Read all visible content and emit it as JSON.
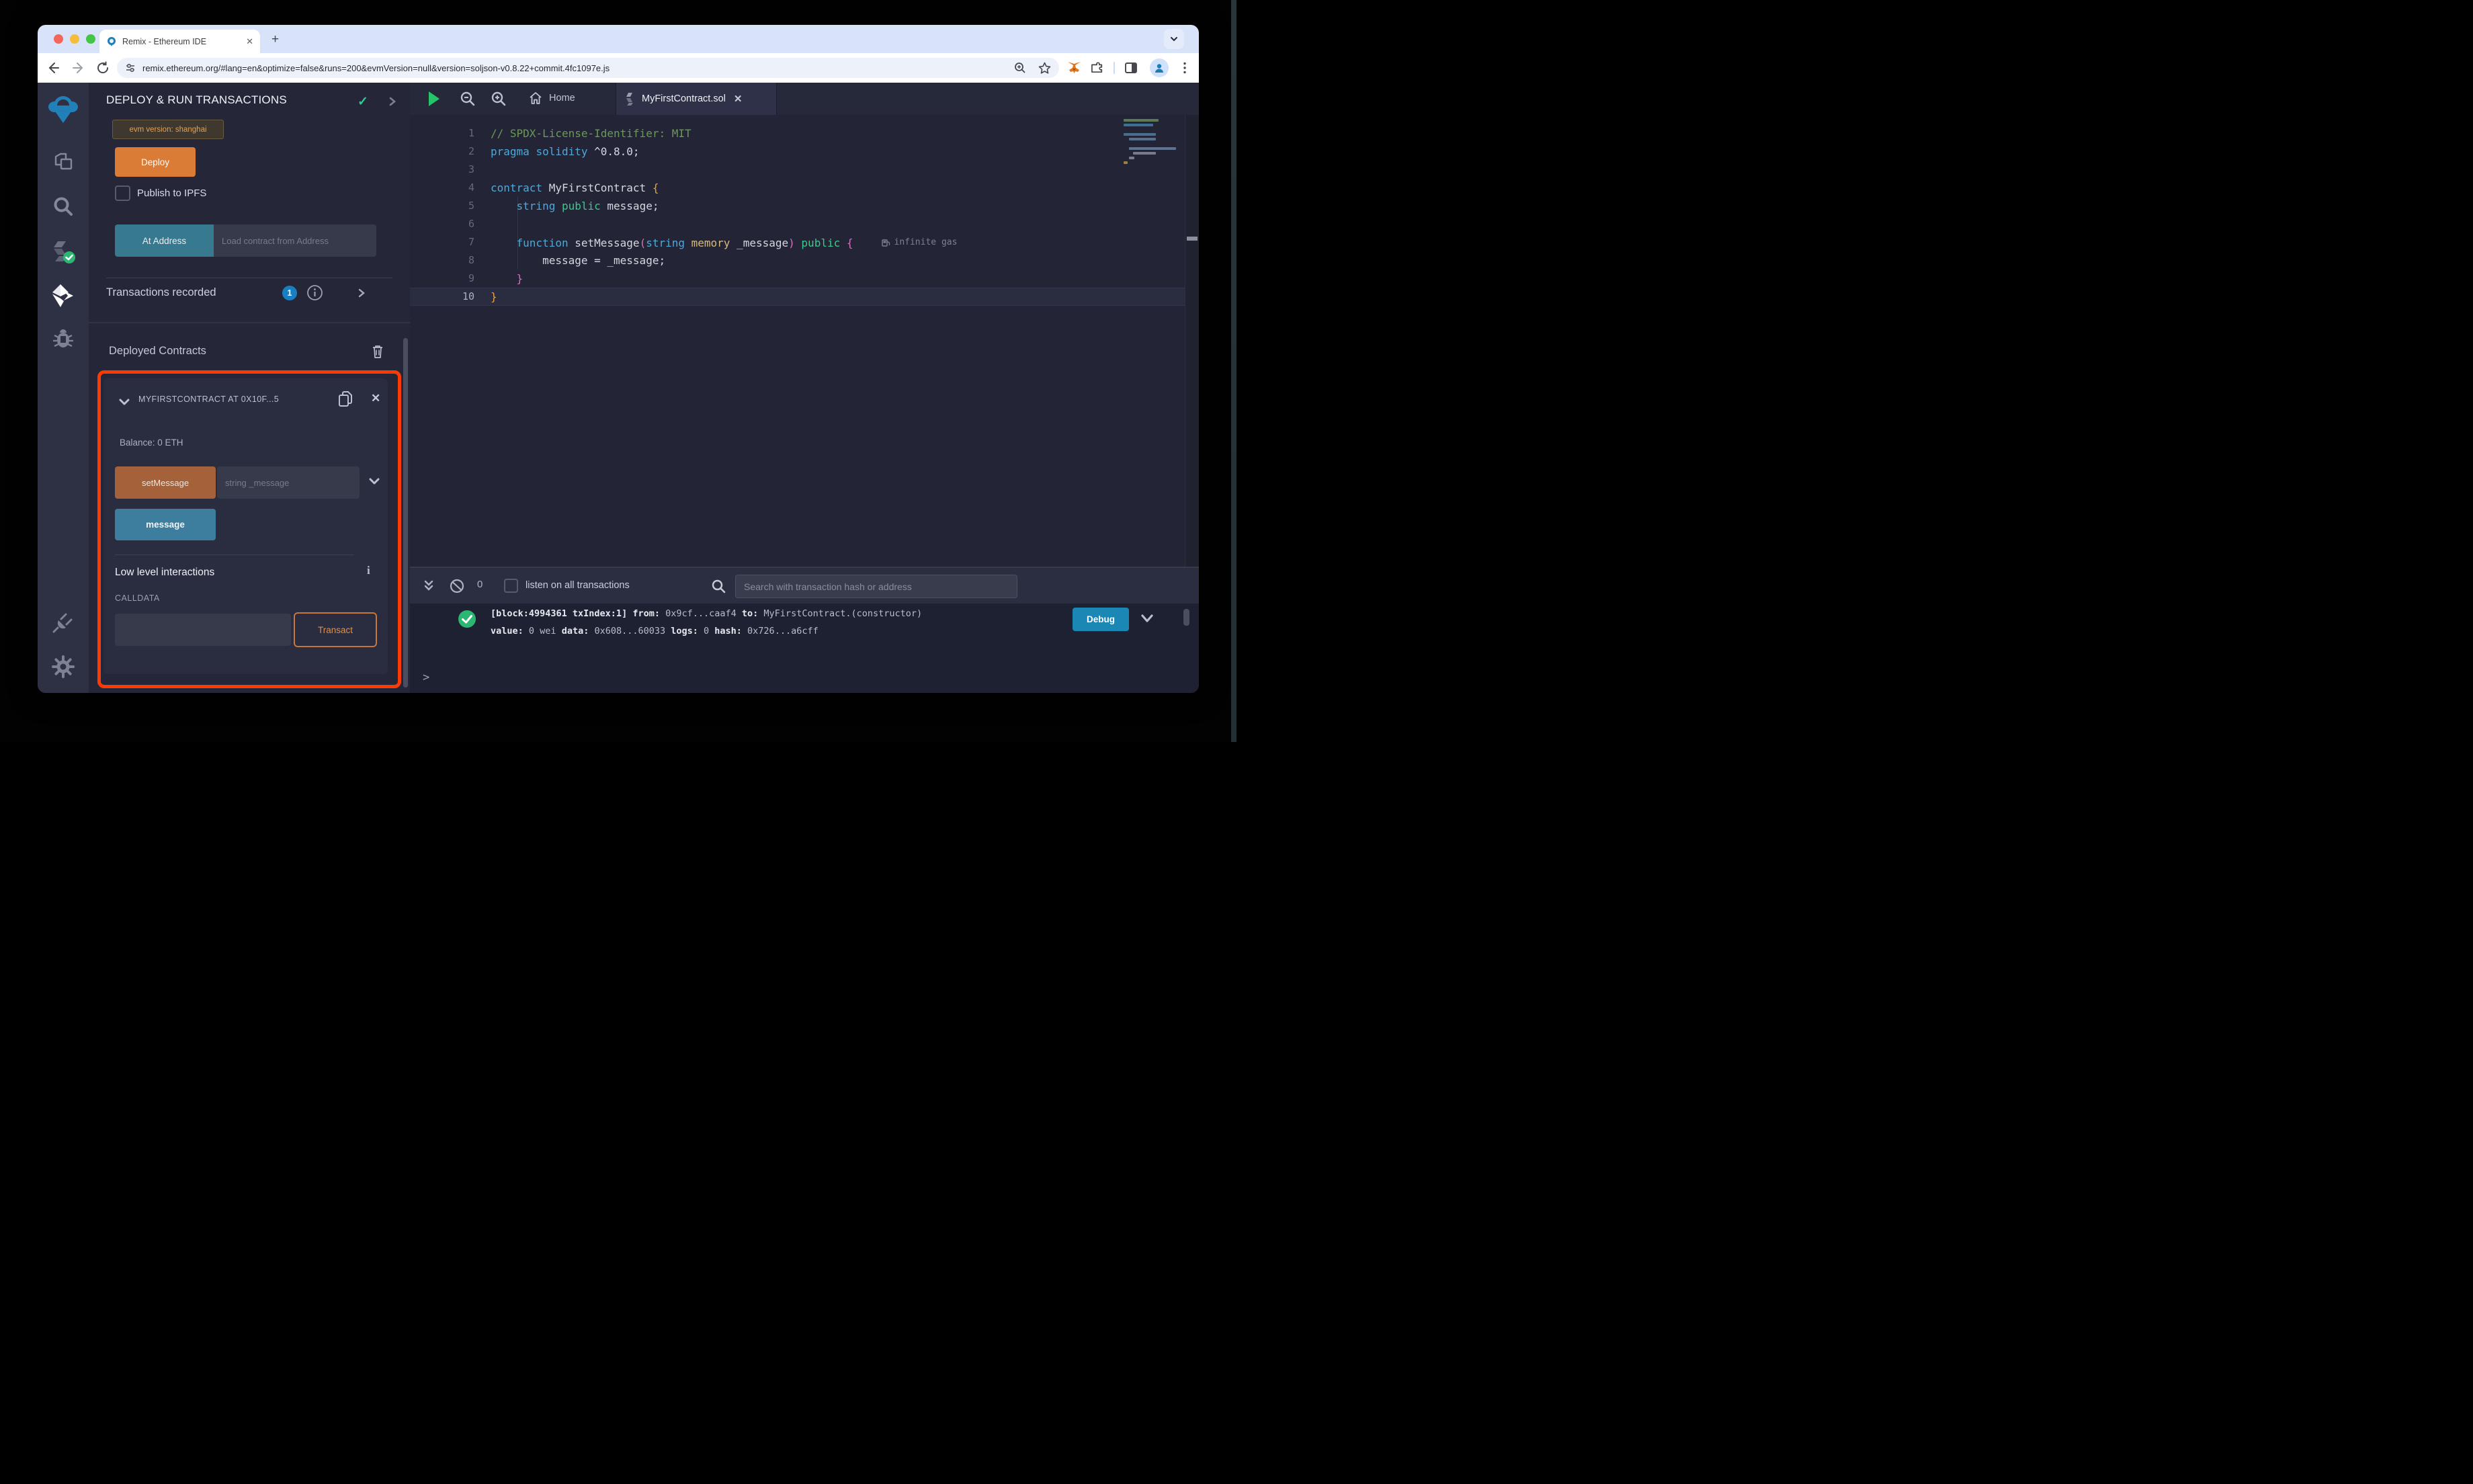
{
  "browser": {
    "tab_title": "Remix - Ethereum IDE",
    "url": "remix.ethereum.org/#lang=en&optimize=false&runs=200&evmVersion=null&version=soljson-v0.8.22+commit.4fc1097e.js"
  },
  "panel": {
    "title": "DEPLOY & RUN TRANSACTIONS",
    "evm_badge": "evm version: shanghai",
    "deploy_label": "Deploy",
    "publish_label": "Publish to IPFS",
    "at_address_label": "At Address",
    "at_address_placeholder": "Load contract from Address",
    "tx_recorded_label": "Transactions recorded",
    "tx_recorded_count": "1",
    "deployed_title": "Deployed Contracts",
    "contract": {
      "header": "MYFIRSTCONTRACT AT 0X10F...5",
      "balance": "Balance: 0 ETH",
      "set_message_label": "setMessage",
      "set_message_placeholder": "string _message",
      "message_label": "message",
      "low_level_title": "Low level interactions",
      "calldata_label": "CALLDATA",
      "transact_label": "Transact"
    }
  },
  "editor": {
    "home_tab": "Home",
    "file_tab": "MyFirstContract.sol",
    "gas_annotation": "infinite gas",
    "code_lines": [
      [
        [
          "cm",
          "// SPDX-License-Identifier: MIT"
        ]
      ],
      [
        [
          "kw",
          "pragma"
        ],
        [
          "pl",
          " "
        ],
        [
          "kw",
          "solidity"
        ],
        [
          "pl",
          " ^0.8.0;"
        ]
      ],
      [],
      [
        [
          "kw",
          "contract"
        ],
        [
          "pl",
          " MyFirstContract "
        ],
        [
          "bo",
          "{"
        ]
      ],
      [
        [
          "pl",
          "    "
        ],
        [
          "kw",
          "string"
        ],
        [
          "pl",
          " "
        ],
        [
          "gr",
          "public"
        ],
        [
          "pl",
          " message;"
        ]
      ],
      [],
      [
        [
          "pl",
          "    "
        ],
        [
          "kw",
          "function"
        ],
        [
          "pl",
          " setMessage"
        ],
        [
          "bp",
          "("
        ],
        [
          "kw",
          "string"
        ],
        [
          "pl",
          " "
        ],
        [
          "ye",
          "memory"
        ],
        [
          "pl",
          " _message"
        ],
        [
          "bp",
          ")"
        ],
        [
          "pl",
          " "
        ],
        [
          "gr",
          "public"
        ],
        [
          "pl",
          " "
        ],
        [
          "bp",
          "{"
        ],
        [
          "gasicon",
          "infinite gas"
        ]
      ],
      [
        [
          "pl",
          "        message = _message;"
        ]
      ],
      [
        [
          "pl",
          "    "
        ],
        [
          "bp",
          "}"
        ]
      ],
      [
        [
          "bo",
          "}"
        ]
      ]
    ]
  },
  "terminal": {
    "count": "0",
    "listen_label": "listen on all transactions",
    "search_placeholder": "Search with transaction hash or address",
    "debug_label": "Debug",
    "prompt": ">",
    "log_lines": [
      [
        [
          "b",
          "[block:4994361 txIndex:1]"
        ],
        [
          "n",
          " "
        ],
        [
          "b",
          "from:"
        ],
        [
          "n",
          " 0x9cf...caaf4 "
        ],
        [
          "b",
          "to:"
        ],
        [
          "n",
          " MyFirstContract.(constructor)"
        ]
      ],
      [
        [
          "b",
          "value:"
        ],
        [
          "n",
          " 0 wei "
        ],
        [
          "b",
          "data:"
        ],
        [
          "n",
          " 0x608...60033 "
        ],
        [
          "b",
          "logs:"
        ],
        [
          "n",
          " 0 "
        ],
        [
          "b",
          "hash:"
        ],
        [
          "n",
          " 0x726...a6cff"
        ]
      ]
    ]
  },
  "colors": {
    "annotation_red": "#fb3a04",
    "deploy_orange": "#da7b36",
    "at_address_teal": "#37798f",
    "message_blue": "#3d7e9e",
    "set_message_brown": "#a5613a",
    "debug_blue": "#1a87b5",
    "success_green": "#2bb673",
    "badge_blue": "#1a7fc2"
  }
}
